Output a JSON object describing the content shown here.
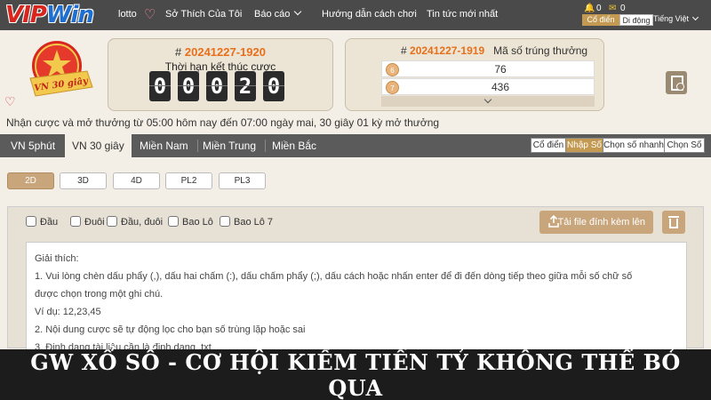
{
  "logo": {
    "vip": "VIP",
    "win": "Win"
  },
  "topnav": {
    "lotto": "lotto",
    "favorites": "Sở Thích Của Tôi",
    "report": "Báo cáo",
    "guide": "Hướng dẫn cách chơi",
    "news": "Tin tức mới nhất",
    "bell_count": "0",
    "msg_count": "0",
    "classic": "Cổ điển",
    "mobile": "Di động",
    "language": "Tiếng Việt"
  },
  "medal": {
    "text": "VN 30 giây"
  },
  "current_draw": {
    "hash": "#",
    "id": "20241227-1920",
    "deadline_label": "Thời hạn kết thúc cược",
    "digits": [
      "0",
      "0",
      "0",
      "2",
      "0"
    ]
  },
  "last_draw": {
    "hash": "#",
    "id": "20241227-1919",
    "label": "Mã số trúng thưởng",
    "rows": [
      {
        "badge": "6",
        "value": "76"
      },
      {
        "badge": "7",
        "value": "436"
      }
    ]
  },
  "info_line": "Nhận cược và mở thưởng từ 05:00 hôm nay đến 07:00 ngày mai,   30 giây 01 kỳ mở thưởng",
  "tabs": [
    "VN 5phút",
    "VN 30 giây",
    "Miền Nam",
    "Miền Trung",
    "Miền Bắc"
  ],
  "modes": [
    "Cổ điển",
    "Nhập Số",
    "Chọn số nhanh",
    "Chọn Số"
  ],
  "game_types": [
    "2D",
    "3D",
    "4D",
    "PL2",
    "PL3"
  ],
  "options": [
    "Đầu",
    "Đuôi",
    "Đầu, đuôi",
    "Bao Lô",
    "Bao Lô 7"
  ],
  "upload_label": "Tải file đính kèm lên",
  "notes": [
    "Giải thích:",
    "1. Vui lòng chèn dấu phẩy (,), dấu hai chấm (:), dấu chấm phẩy (;), dấu cách hoặc nhấn enter để đi đến dòng tiếp theo giữa mỗi số chữ số",
    "được chọn trong một ghi chú.",
    "Ví dụ: 12,23,45",
    "2. Nội dung cược sẽ tự động lọc cho bạn số trùng lặp hoặc sai",
    "3. Định dạng tài liệu cần là định dạng .txt"
  ],
  "banner": "GW XỔ SỐ - CƠ HỘI KIẾM TIỀN TỶ KHÔNG THỂ BỎ QUA",
  "colors": {
    "accent": "#c8a57b",
    "draw_id": "#e86f1a",
    "nav_bg": "#4a4a4a",
    "banner_bg": "#1c1c1c"
  }
}
